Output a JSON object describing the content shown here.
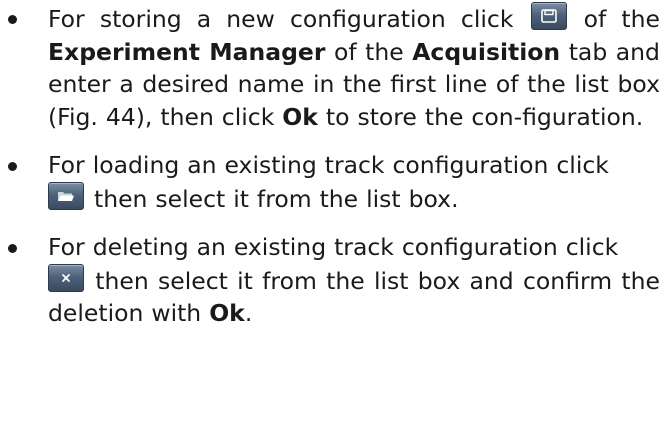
{
  "items": [
    {
      "t1": "For storing a new configuration click",
      "t2": "of the",
      "b1": "Experiment Manager",
      "t3": "of the",
      "b2": "Acquisition",
      "t4": "tab and enter a desired name in the first line of the list box (Fig. 44), then click",
      "b3": "Ok",
      "t5": "to store the con-figuration.",
      "icon": "save-icon"
    },
    {
      "t1": "For loading an existing track configuration click",
      "t2": "then select it from the list box.",
      "icon": "open-folder-icon"
    },
    {
      "t1": "For deleting an existing track configuration click",
      "t2": "then select it from the list box and confirm the deletion with",
      "b1": "Ok",
      "t3": ".",
      "icon": "delete-icon"
    }
  ],
  "colors": {
    "text": "#1a1a1a",
    "button": "#4f627a"
  }
}
